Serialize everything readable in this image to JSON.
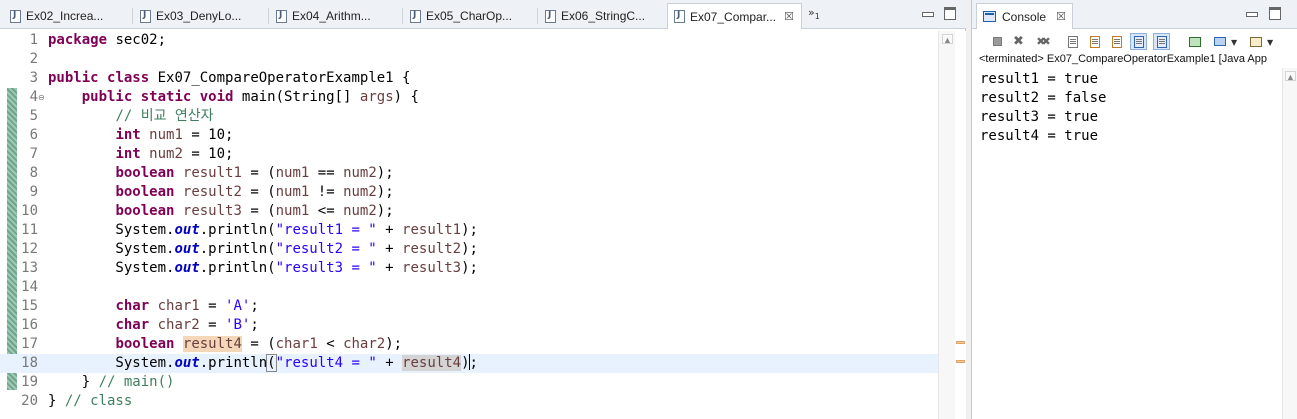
{
  "editor": {
    "tabs": [
      {
        "label": "Ex02_Increa...",
        "active": false
      },
      {
        "label": "Ex03_DenyLo...",
        "active": false
      },
      {
        "label": "Ex04_Arithm...",
        "active": false
      },
      {
        "label": "Ex05_CharOp...",
        "active": false
      },
      {
        "label": "Ex06_StringC...",
        "active": false
      },
      {
        "label": "Ex07_Compar...",
        "active": true,
        "close": "☒"
      }
    ],
    "overflow_count": "1",
    "overflow_glyph": "»",
    "line_numbers": [
      "1",
      "2",
      "3",
      "4",
      "5",
      "6",
      "7",
      "8",
      "9",
      "10",
      "11",
      "12",
      "13",
      "14",
      "15",
      "16",
      "17",
      "18",
      "19",
      "20"
    ],
    "fold_marker": "⊖",
    "current_line": 18,
    "lines": [
      [
        {
          "t": "package",
          "c": "kw"
        },
        {
          "t": " sec02;"
        }
      ],
      [],
      [
        {
          "t": "public",
          "c": "kw"
        },
        {
          "t": " "
        },
        {
          "t": "class",
          "c": "kw"
        },
        {
          "t": " Ex07_CompareOperatorExample1 {"
        }
      ],
      [
        {
          "t": "    "
        },
        {
          "t": "public",
          "c": "kw"
        },
        {
          "t": " "
        },
        {
          "t": "static",
          "c": "kw"
        },
        {
          "t": " "
        },
        {
          "t": "void",
          "c": "kw"
        },
        {
          "t": " main(String[] "
        },
        {
          "t": "args",
          "c": "var"
        },
        {
          "t": ") {"
        }
      ],
      [
        {
          "t": "        "
        },
        {
          "t": "// 비교 연산자",
          "c": "cmt"
        }
      ],
      [
        {
          "t": "        "
        },
        {
          "t": "int",
          "c": "kw"
        },
        {
          "t": " "
        },
        {
          "t": "num1",
          "c": "var"
        },
        {
          "t": " = 10;"
        }
      ],
      [
        {
          "t": "        "
        },
        {
          "t": "int",
          "c": "kw"
        },
        {
          "t": " "
        },
        {
          "t": "num2",
          "c": "var"
        },
        {
          "t": " = 10;"
        }
      ],
      [
        {
          "t": "        "
        },
        {
          "t": "boolean",
          "c": "kw"
        },
        {
          "t": " "
        },
        {
          "t": "result1",
          "c": "var"
        },
        {
          "t": " = ("
        },
        {
          "t": "num1",
          "c": "var"
        },
        {
          "t": " == "
        },
        {
          "t": "num2",
          "c": "var"
        },
        {
          "t": ");"
        }
      ],
      [
        {
          "t": "        "
        },
        {
          "t": "boolean",
          "c": "kw"
        },
        {
          "t": " "
        },
        {
          "t": "result2",
          "c": "var"
        },
        {
          "t": " = ("
        },
        {
          "t": "num1",
          "c": "var"
        },
        {
          "t": " != "
        },
        {
          "t": "num2",
          "c": "var"
        },
        {
          "t": ");"
        }
      ],
      [
        {
          "t": "        "
        },
        {
          "t": "boolean",
          "c": "kw"
        },
        {
          "t": " "
        },
        {
          "t": "result3",
          "c": "var"
        },
        {
          "t": " = ("
        },
        {
          "t": "num1",
          "c": "var"
        },
        {
          "t": " <= "
        },
        {
          "t": "num2",
          "c": "var"
        },
        {
          "t": ");"
        }
      ],
      [
        {
          "t": "        System."
        },
        {
          "t": "out",
          "c": "fld"
        },
        {
          "t": ".println("
        },
        {
          "t": "\"result1 = \"",
          "c": "str"
        },
        {
          "t": " + "
        },
        {
          "t": "result1",
          "c": "var"
        },
        {
          "t": ");"
        }
      ],
      [
        {
          "t": "        System."
        },
        {
          "t": "out",
          "c": "fld"
        },
        {
          "t": ".println("
        },
        {
          "t": "\"result2 = \"",
          "c": "str"
        },
        {
          "t": " + "
        },
        {
          "t": "result2",
          "c": "var"
        },
        {
          "t": ");"
        }
      ],
      [
        {
          "t": "        System."
        },
        {
          "t": "out",
          "c": "fld"
        },
        {
          "t": ".println("
        },
        {
          "t": "\"result3 = \"",
          "c": "str"
        },
        {
          "t": " + "
        },
        {
          "t": "result3",
          "c": "var"
        },
        {
          "t": ");"
        }
      ],
      [],
      [
        {
          "t": "        "
        },
        {
          "t": "char",
          "c": "kw"
        },
        {
          "t": " "
        },
        {
          "t": "char1",
          "c": "var"
        },
        {
          "t": " = "
        },
        {
          "t": "'A'",
          "c": "str"
        },
        {
          "t": ";"
        }
      ],
      [
        {
          "t": "        "
        },
        {
          "t": "char",
          "c": "kw"
        },
        {
          "t": " "
        },
        {
          "t": "char2",
          "c": "var"
        },
        {
          "t": " = "
        },
        {
          "t": "'B'",
          "c": "str"
        },
        {
          "t": ";"
        }
      ],
      [
        {
          "t": "        "
        },
        {
          "t": "boolean",
          "c": "kw"
        },
        {
          "t": " "
        },
        {
          "t": "result4",
          "c": "var occ-write"
        },
        {
          "t": " = ("
        },
        {
          "t": "char1",
          "c": "var"
        },
        {
          "t": " < "
        },
        {
          "t": "char2",
          "c": "var"
        },
        {
          "t": ");"
        }
      ],
      [
        {
          "t": "        System."
        },
        {
          "t": "out",
          "c": "fld"
        },
        {
          "t": ".println"
        },
        {
          "t": "(",
          "c": "brk"
        },
        {
          "t": "\"result4 = \"",
          "c": "str"
        },
        {
          "t": " + "
        },
        {
          "t": "result4",
          "c": "var occ-read"
        },
        {
          "t": ")",
          "c": "caret-after"
        },
        {
          "t": ";"
        }
      ],
      [
        {
          "t": "    } "
        },
        {
          "t": "// main()",
          "c": "cmt"
        }
      ],
      [
        {
          "t": "} "
        },
        {
          "t": "// class",
          "c": "cmt"
        }
      ]
    ]
  },
  "console": {
    "tab_label": "Console",
    "tab_close": "☒",
    "status": "<terminated> Ex07_CompareOperatorExample1 [Java App",
    "output": [
      "result1 = true",
      "result2 = false",
      "result3 = true",
      "result4 = true"
    ]
  }
}
